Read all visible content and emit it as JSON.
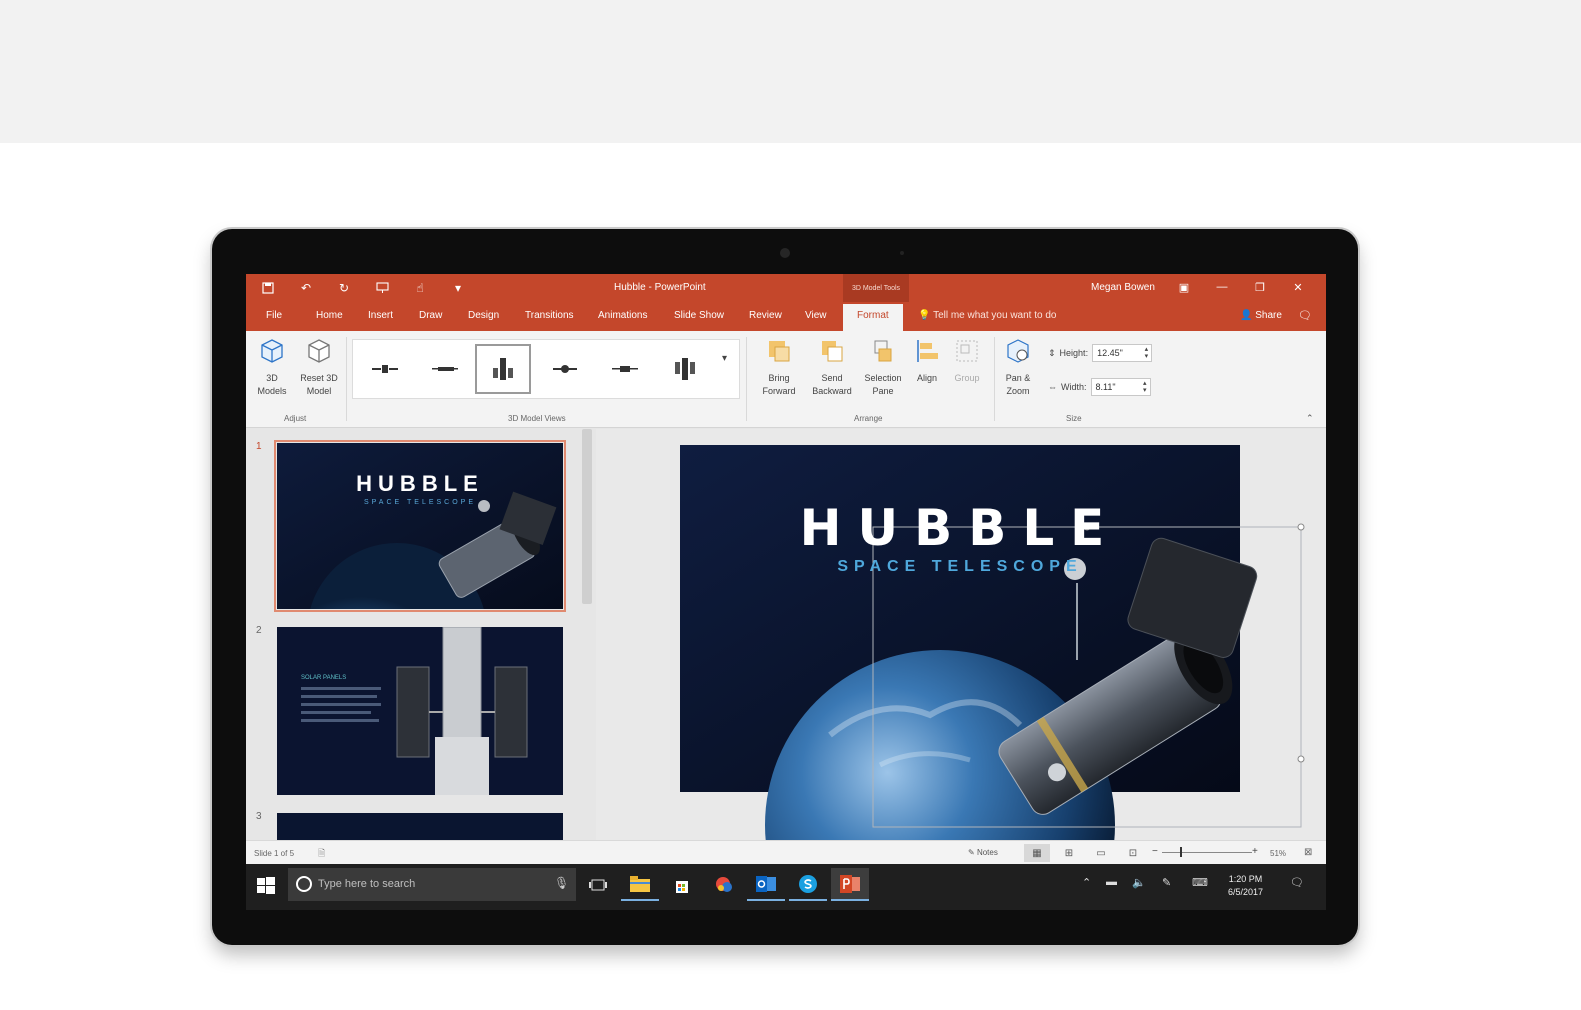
{
  "titlebar": {
    "doc_title": "Hubble  -  PowerPoint",
    "context_tab": "3D Model Tools",
    "user": "Megan Bowen",
    "qat_icons": [
      "save-icon",
      "undo-icon",
      "redo-icon",
      "present-icon",
      "touch-mode-icon",
      "customize-icon"
    ]
  },
  "tabs": [
    {
      "label": "File"
    },
    {
      "label": "Home"
    },
    {
      "label": "Insert"
    },
    {
      "label": "Draw"
    },
    {
      "label": "Design"
    },
    {
      "label": "Transitions"
    },
    {
      "label": "Animations"
    },
    {
      "label": "Slide Show"
    },
    {
      "label": "Review"
    },
    {
      "label": "View"
    },
    {
      "label": "Format"
    }
  ],
  "tellme": "Tell me what you want to do",
  "share": "Share",
  "ribbon": {
    "models_l1": "3D",
    "models_l2": "Models",
    "reset_l1": "Reset 3D",
    "reset_l2": "Model",
    "group_adjust": "Adjust",
    "group_views": "3D Model Views",
    "bring_l1": "Bring",
    "bring_l2": "Forward",
    "send_l1": "Send",
    "send_l2": "Backward",
    "selection_l1": "Selection",
    "selection_l2": "Pane",
    "align": "Align",
    "group_btn": "Group",
    "group_arrange": "Arrange",
    "pan_l1": "Pan &",
    "pan_l2": "Zoom",
    "height_label": "Height:",
    "height_value": "12.45\"",
    "width_label": "Width:",
    "width_value": "8.11\"",
    "group_size": "Size"
  },
  "slides": {
    "nums": [
      "1",
      "2",
      "3"
    ],
    "thumb1_title": "HUBBLE",
    "thumb1_sub": "SPACE TELESCOPE",
    "thumb2_heading": "SOLAR PANELS"
  },
  "main_slide": {
    "title": "HUBBLE",
    "subtitle": "SPACE TELESCOPE"
  },
  "status": {
    "slide_info": "Slide 1 of 5",
    "notes": "Notes",
    "zoom": "51%"
  },
  "taskbar": {
    "search_placeholder": "Type here to search",
    "time": "1:20 PM",
    "date": "6/5/2017"
  },
  "colors": {
    "accent": "#c4472b",
    "ribbon": "#f3f3f3",
    "taskbar": "#1f1f1f"
  }
}
